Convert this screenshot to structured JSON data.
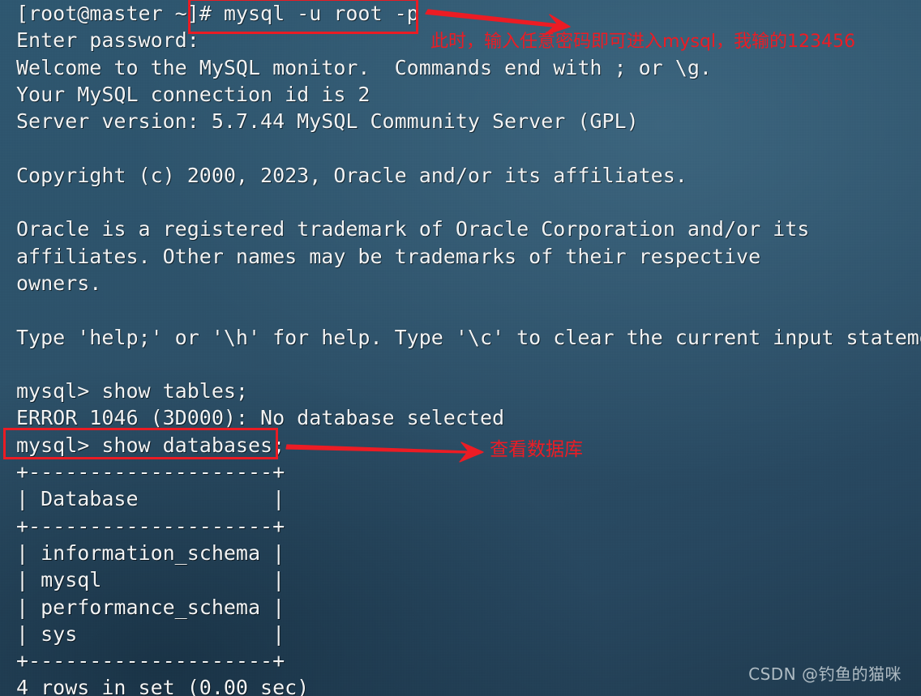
{
  "terminal": {
    "prompt_user": "root",
    "prompt_host": "master",
    "lines": [
      "[root@master ~]# mysql -u root -p",
      "Enter password:",
      "Welcome to the MySQL monitor.  Commands end with ; or \\g.",
      "Your MySQL connection id is 2",
      "Server version: 5.7.44 MySQL Community Server (GPL)",
      "",
      "Copyright (c) 2000, 2023, Oracle and/or its affiliates.",
      "",
      "Oracle is a registered trademark of Oracle Corporation and/or its",
      "affiliates. Other names may be trademarks of their respective",
      "owners.",
      "",
      "Type 'help;' or '\\h' for help. Type '\\c' to clear the current input statement.",
      "",
      "mysql> show tables;",
      "ERROR 1046 (3D000): No database selected",
      "mysql> show databases;",
      "+--------------------+",
      "| Database           |",
      "+--------------------+",
      "| information_schema |",
      "| mysql              |",
      "| performance_schema |",
      "| sys                |",
      "+--------------------+",
      "4 rows in set (0.00 sec)"
    ],
    "full_text": "[root@master ~]# mysql -u root -p\nEnter password:\nWelcome to the MySQL monitor.  Commands end with ; or \\g.\nYour MySQL connection id is 2\nServer version: 5.7.44 MySQL Community Server (GPL)\n\nCopyright (c) 2000, 2023, Oracle and/or its affiliates.\n\nOracle is a registered trademark of Oracle Corporation and/or its\naffiliates. Other names may be trademarks of their respective\nowners.\n\nType 'help;' or '\\h' for help. Type '\\c' to clear the current input statement.\n\nmysql> show tables;\nERROR 1046 (3D000): No database selected\nmysql> show databases;\n+--------------------+\n| Database           |\n+--------------------+\n| information_schema |\n| mysql              |\n| performance_schema |\n| sys                |\n+--------------------+\n4 rows in set (0.00 sec)",
    "commands": [
      "mysql -u root -p",
      "show tables;",
      "show databases;"
    ],
    "mysql": {
      "connection_id": "2",
      "server_version": "5.7.44 MySQL Community Server (GPL)",
      "copyright_years": "2000, 2023",
      "error_code": "ERROR 1046 (3D000)",
      "error_message": "No database selected",
      "result_rows": "4 rows in set (0.00 sec)"
    },
    "databases_table": {
      "header": "Database",
      "rows": [
        "information_schema",
        "mysql",
        "performance_schema",
        "sys"
      ],
      "row_count": 4,
      "elapsed": "0.00 sec"
    }
  },
  "annotations": {
    "password_note": "此时，输入任意密码即可进入mysql，我输的123456",
    "show_databases_note": "查看数据库"
  },
  "watermark": {
    "text": "CSDN @钓鱼的猫咪"
  },
  "colors": {
    "background": "#2d5169",
    "terminal_text": "#f2f4f5",
    "annotation_red": "#ec1c24",
    "box_red": "#ea1c24"
  }
}
